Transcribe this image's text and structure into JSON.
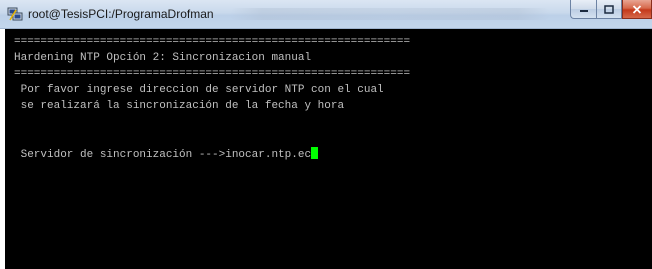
{
  "window": {
    "title": "root@TesisPCI:/ProgramaDrofman",
    "icon": "putty-icon"
  },
  "terminal": {
    "lines": [
      "============================================================",
      "Hardening NTP Opción 2: Sincronizacion manual",
      "============================================================",
      " Por favor ingrese direccion de servidor NTP con el cual",
      " se realizará la sincronización de la fecha y hora",
      "",
      "",
      " Servidor de sincronización --->inocar.ntp.ec"
    ],
    "cursor_color": "#00ff00",
    "text_color": "#c0c0c0",
    "background": "#000000"
  }
}
